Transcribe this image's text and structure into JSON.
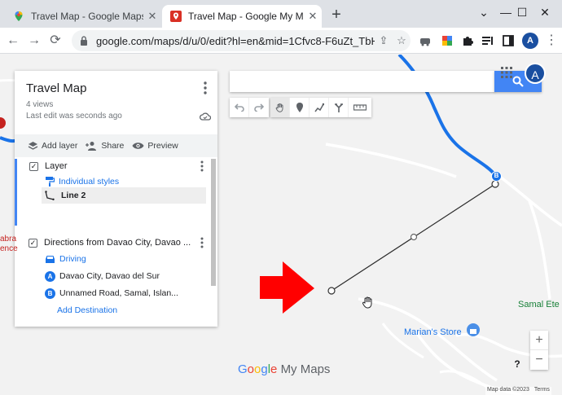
{
  "browser": {
    "tabs": [
      {
        "title": "Travel Map - Google Maps",
        "favicon": "google-maps-pin-icon",
        "active": false
      },
      {
        "title": "Travel Map - Google My Maps",
        "favicon": "my-maps-pin-icon",
        "active": true
      }
    ],
    "url": "google.com/maps/d/u/0/edit?hl=en&mid=1Cfvc8-F6uZt_TbHhP...",
    "profile_initial": "A"
  },
  "map": {
    "search_value": "",
    "account_initial": "A",
    "tools": [
      "undo-icon",
      "redo-icon",
      "hand-pan-icon",
      "add-marker-icon",
      "draw-line-icon",
      "directions-icon",
      "measure-ruler-icon"
    ],
    "place_labels": {
      "samal": "Samal Ete",
      "marians_store": "Marian's Store",
      "left_edge_1": "abra",
      "left_edge_2": "ence"
    },
    "waypoint_marker": "B",
    "logo": {
      "g1": "G",
      "o1": "o",
      "o2": "o",
      "g2": "g",
      "l": "l",
      "e": "e",
      "suffix": "My Maps"
    },
    "zoom_in": "+",
    "zoom_out": "−",
    "help": "?",
    "attribution": {
      "data": "Map data ©2023",
      "terms": "Terms"
    },
    "colors": {
      "route": "#1a73e8",
      "arrow": "#ff0000",
      "background": "#f2f2f2"
    }
  },
  "panel": {
    "title": "Travel Map",
    "views": "4 views",
    "last_edit": "Last edit was seconds ago",
    "actions": {
      "add_layer": "Add layer",
      "share": "Share",
      "preview": "Preview"
    },
    "layer1": {
      "name": "Layer",
      "style": "Individual styles",
      "item": "Line 2"
    },
    "layer2": {
      "name": "Directions from Davao City, Davao ...",
      "mode": "Driving",
      "stop_a_letter": "A",
      "stop_a": "Davao City, Davao del Sur",
      "stop_b_letter": "B",
      "stop_b": "Unnamed Road, Samal, Islan...",
      "add_destination": "Add Destination"
    }
  }
}
